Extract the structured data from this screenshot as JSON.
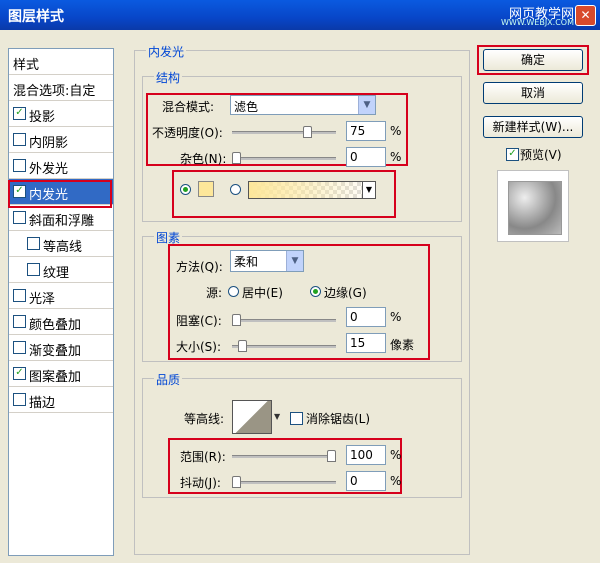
{
  "window": {
    "title": "图层样式",
    "watermark": "网页教学网",
    "watermark_url": "WWW.WEBJX.COM"
  },
  "sidebar": {
    "header": "样式",
    "items": [
      {
        "label": "混合选项:自定",
        "checkbox": false,
        "checked": false,
        "selected": false
      },
      {
        "label": "投影",
        "checkbox": true,
        "checked": true,
        "selected": false
      },
      {
        "label": "内阴影",
        "checkbox": true,
        "checked": false,
        "selected": false
      },
      {
        "label": "外发光",
        "checkbox": true,
        "checked": false,
        "selected": false
      },
      {
        "label": "内发光",
        "checkbox": true,
        "checked": true,
        "selected": true
      },
      {
        "label": "斜面和浮雕",
        "checkbox": true,
        "checked": false,
        "selected": false
      },
      {
        "label": "等高线",
        "checkbox": true,
        "checked": false,
        "selected": false
      },
      {
        "label": "纹理",
        "checkbox": true,
        "checked": false,
        "selected": false
      },
      {
        "label": "光泽",
        "checkbox": true,
        "checked": false,
        "selected": false
      },
      {
        "label": "颜色叠加",
        "checkbox": true,
        "checked": false,
        "selected": false
      },
      {
        "label": "渐变叠加",
        "checkbox": true,
        "checked": false,
        "selected": false
      },
      {
        "label": "图案叠加",
        "checkbox": true,
        "checked": true,
        "selected": false
      },
      {
        "label": "描边",
        "checkbox": true,
        "checked": false,
        "selected": false
      }
    ]
  },
  "main": {
    "section_title": "内发光",
    "structure": {
      "title": "结构",
      "blend_mode_label": "混合模式:",
      "blend_mode_value": "滤色",
      "opacity_label": "不透明度(O):",
      "opacity_value": "75",
      "opacity_fraction": 0.75,
      "noise_label": "杂色(N):",
      "noise_value": "0",
      "noise_fraction": 0,
      "unit": "%"
    },
    "elements": {
      "title": "图素",
      "method_label": "方法(Q):",
      "method_value": "柔和",
      "source_label": "源:",
      "source_center": "居中(E)",
      "source_edge": "边缘(G)",
      "choke_label": "阻塞(C):",
      "choke_value": "0",
      "choke_fraction": 0,
      "size_label": "大小(S):",
      "size_value": "15",
      "size_fraction": 0.06,
      "percent_unit": "%",
      "pixel_unit": "像素"
    },
    "quality": {
      "title": "品质",
      "contour_label": "等高线:",
      "antialias_label": "消除锯齿(L)",
      "range_label": "范围(R):",
      "range_value": "100",
      "range_fraction": 1.0,
      "jitter_label": "抖动(J):",
      "jitter_value": "0",
      "jitter_fraction": 0,
      "unit": "%"
    }
  },
  "buttons": {
    "ok": "确定",
    "cancel": "取消",
    "new_style": "新建样式(W)...",
    "preview_label": "预览(V)"
  }
}
